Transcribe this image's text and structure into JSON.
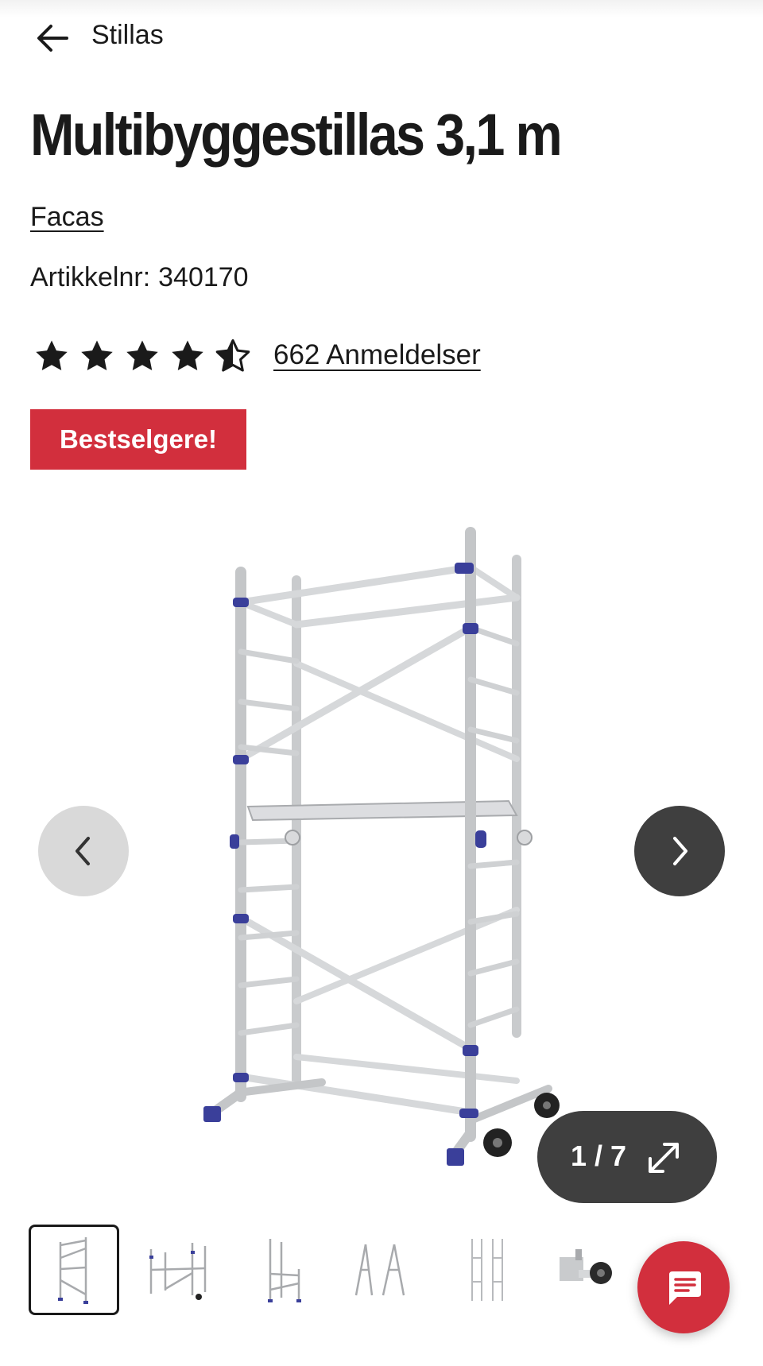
{
  "header": {
    "back_icon": "arrow-left-icon",
    "breadcrumb": "Stillas"
  },
  "product": {
    "title": "Multibyggestillas 3,1 m",
    "brand": "Facas",
    "sku_label": "Artikkelnr:",
    "sku_value": "340170",
    "rating": 4.5,
    "rating_max": 5,
    "reviews_label": "662 Anmeldelser",
    "badge": "Bestselgere!"
  },
  "gallery": {
    "current": "1",
    "total": "7",
    "prev_icon": "chevron-left-icon",
    "next_icon": "chevron-right-icon",
    "expand_icon": "expand-icon",
    "thumbnail_count": 6,
    "active_thumbnail": 1
  },
  "chat": {
    "icon": "chat-icon"
  },
  "colors": {
    "accent_red": "#d22f3d",
    "dark_button": "#3f3f3f",
    "light_button": "#d9d9d9",
    "text": "#1a1a1a",
    "scaffold_clamp": "#3a3f9a"
  }
}
